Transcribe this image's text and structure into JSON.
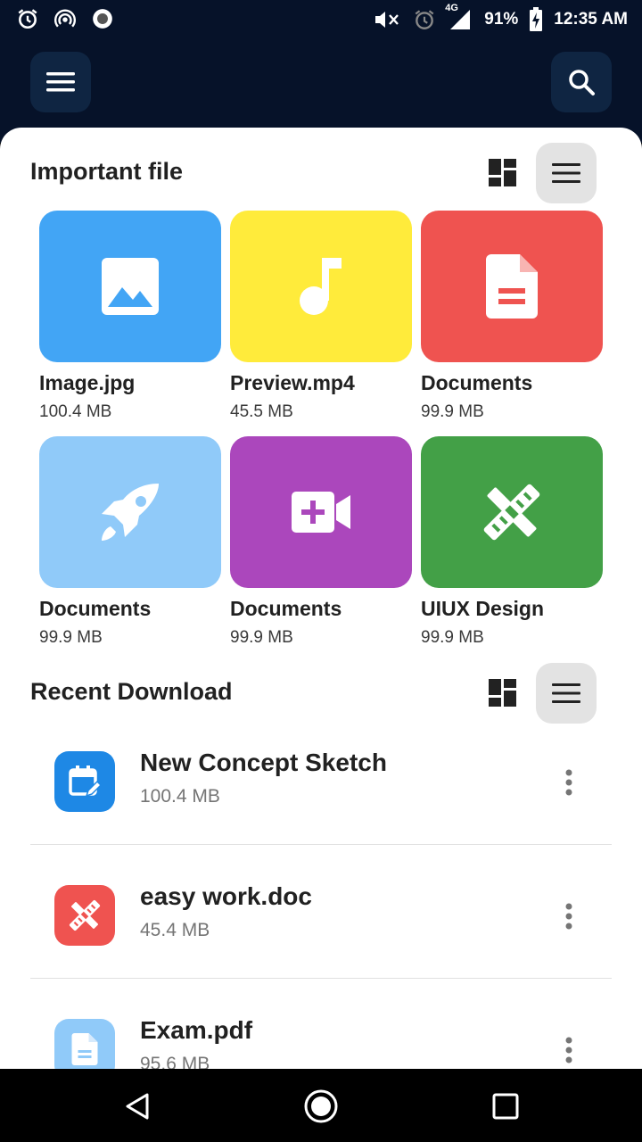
{
  "status_bar": {
    "battery": "91%",
    "time": "12:35 AM",
    "network": "4G",
    "left_icons": [
      "alarm-icon",
      "hotspot-icon",
      "record-icon"
    ],
    "right_icons": [
      "mute-icon",
      "alarm-icon",
      "signal-icon",
      "battery-charging-icon"
    ]
  },
  "app_bar": {
    "menu_icon": "menu-icon",
    "search_icon": "search-icon"
  },
  "important": {
    "title": "Important file",
    "files": [
      {
        "name": "Image.jpg",
        "size": "100.4 MB",
        "color": "#42a5f5",
        "icon": "image-icon"
      },
      {
        "name": "Preview.mp4",
        "size": "45.5 MB",
        "color": "#ffeb3b",
        "icon": "music-note-icon"
      },
      {
        "name": "Documents",
        "size": "99.9 MB",
        "color": "#ef5350",
        "icon": "document-icon"
      },
      {
        "name": "Documents",
        "size": "99.9 MB",
        "color": "#90caf9",
        "icon": "rocket-icon"
      },
      {
        "name": "Documents",
        "size": "99.9 MB",
        "color": "#ab47bc",
        "icon": "video-add-icon"
      },
      {
        "name": "UIUX Design",
        "size": "99.9 MB",
        "color": "#43a047",
        "icon": "design-tools-icon"
      }
    ]
  },
  "recent": {
    "title": "Recent Download",
    "items": [
      {
        "name": "New Concept Sketch",
        "size": "100.4 MB",
        "color": "#1e88e5",
        "icon": "calendar-edit-icon"
      },
      {
        "name": "easy work.doc",
        "size": "45.4 MB",
        "color": "#ef5350",
        "icon": "design-tools-icon"
      },
      {
        "name": "Exam.pdf",
        "size": "95.6 MB",
        "color": "#90caf9",
        "icon": "document-icon"
      }
    ]
  },
  "colors": {
    "header_bg": "#061229",
    "header_button_bg": "#0f2542",
    "active_view_bg": "#e3e3e3"
  }
}
